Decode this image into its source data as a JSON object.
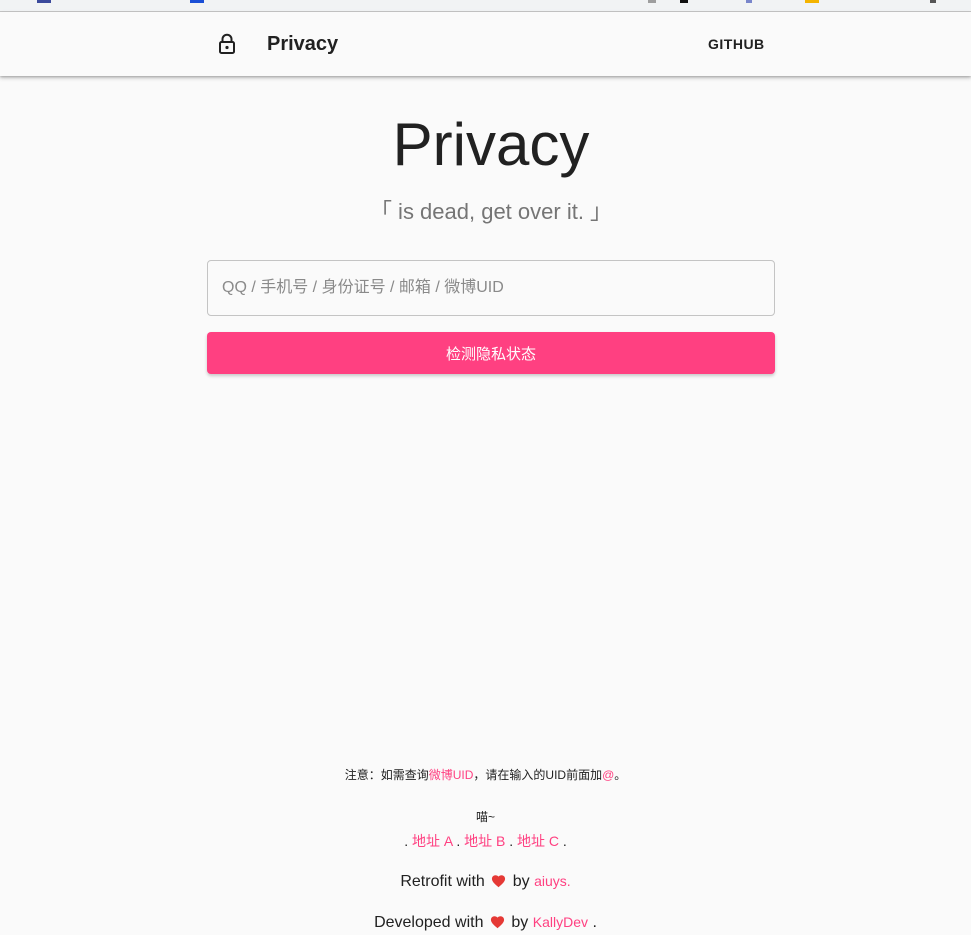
{
  "appbar": {
    "title": "Privacy",
    "github_label": "GITHUB"
  },
  "hero": {
    "title": "Privacy",
    "subtitle": "「 is dead, get over it. 」"
  },
  "search": {
    "placeholder": "QQ / 手机号 / 身份证号 / 邮箱 / 微博UID",
    "value": "",
    "button_label": "检测隐私状态"
  },
  "footer": {
    "note_prefix": "注意：如需查询",
    "note_link": "微博UID",
    "note_middle": "，请在输入的UID前面加",
    "note_at": "@",
    "note_suffix": "。",
    "meow": "喵~",
    "mirror_sep": ".",
    "mirrors": [
      "地址 A",
      "地址 B",
      "地址 C"
    ],
    "retrofit_prefix": "Retrofit with",
    "retrofit_by": "by",
    "retrofit_author": "aiuys.",
    "developed_prefix": "Developed with",
    "developed_by": "by",
    "developed_author": "KallyDev",
    "developed_suffix": "."
  },
  "colors": {
    "accent": "#ff4081",
    "heart": "#e53935",
    "text": "#212121",
    "subtitle": "#757575",
    "background": "#fafafa"
  },
  "icons": {
    "lock": "lock-open-icon",
    "heart": "heart-icon"
  }
}
